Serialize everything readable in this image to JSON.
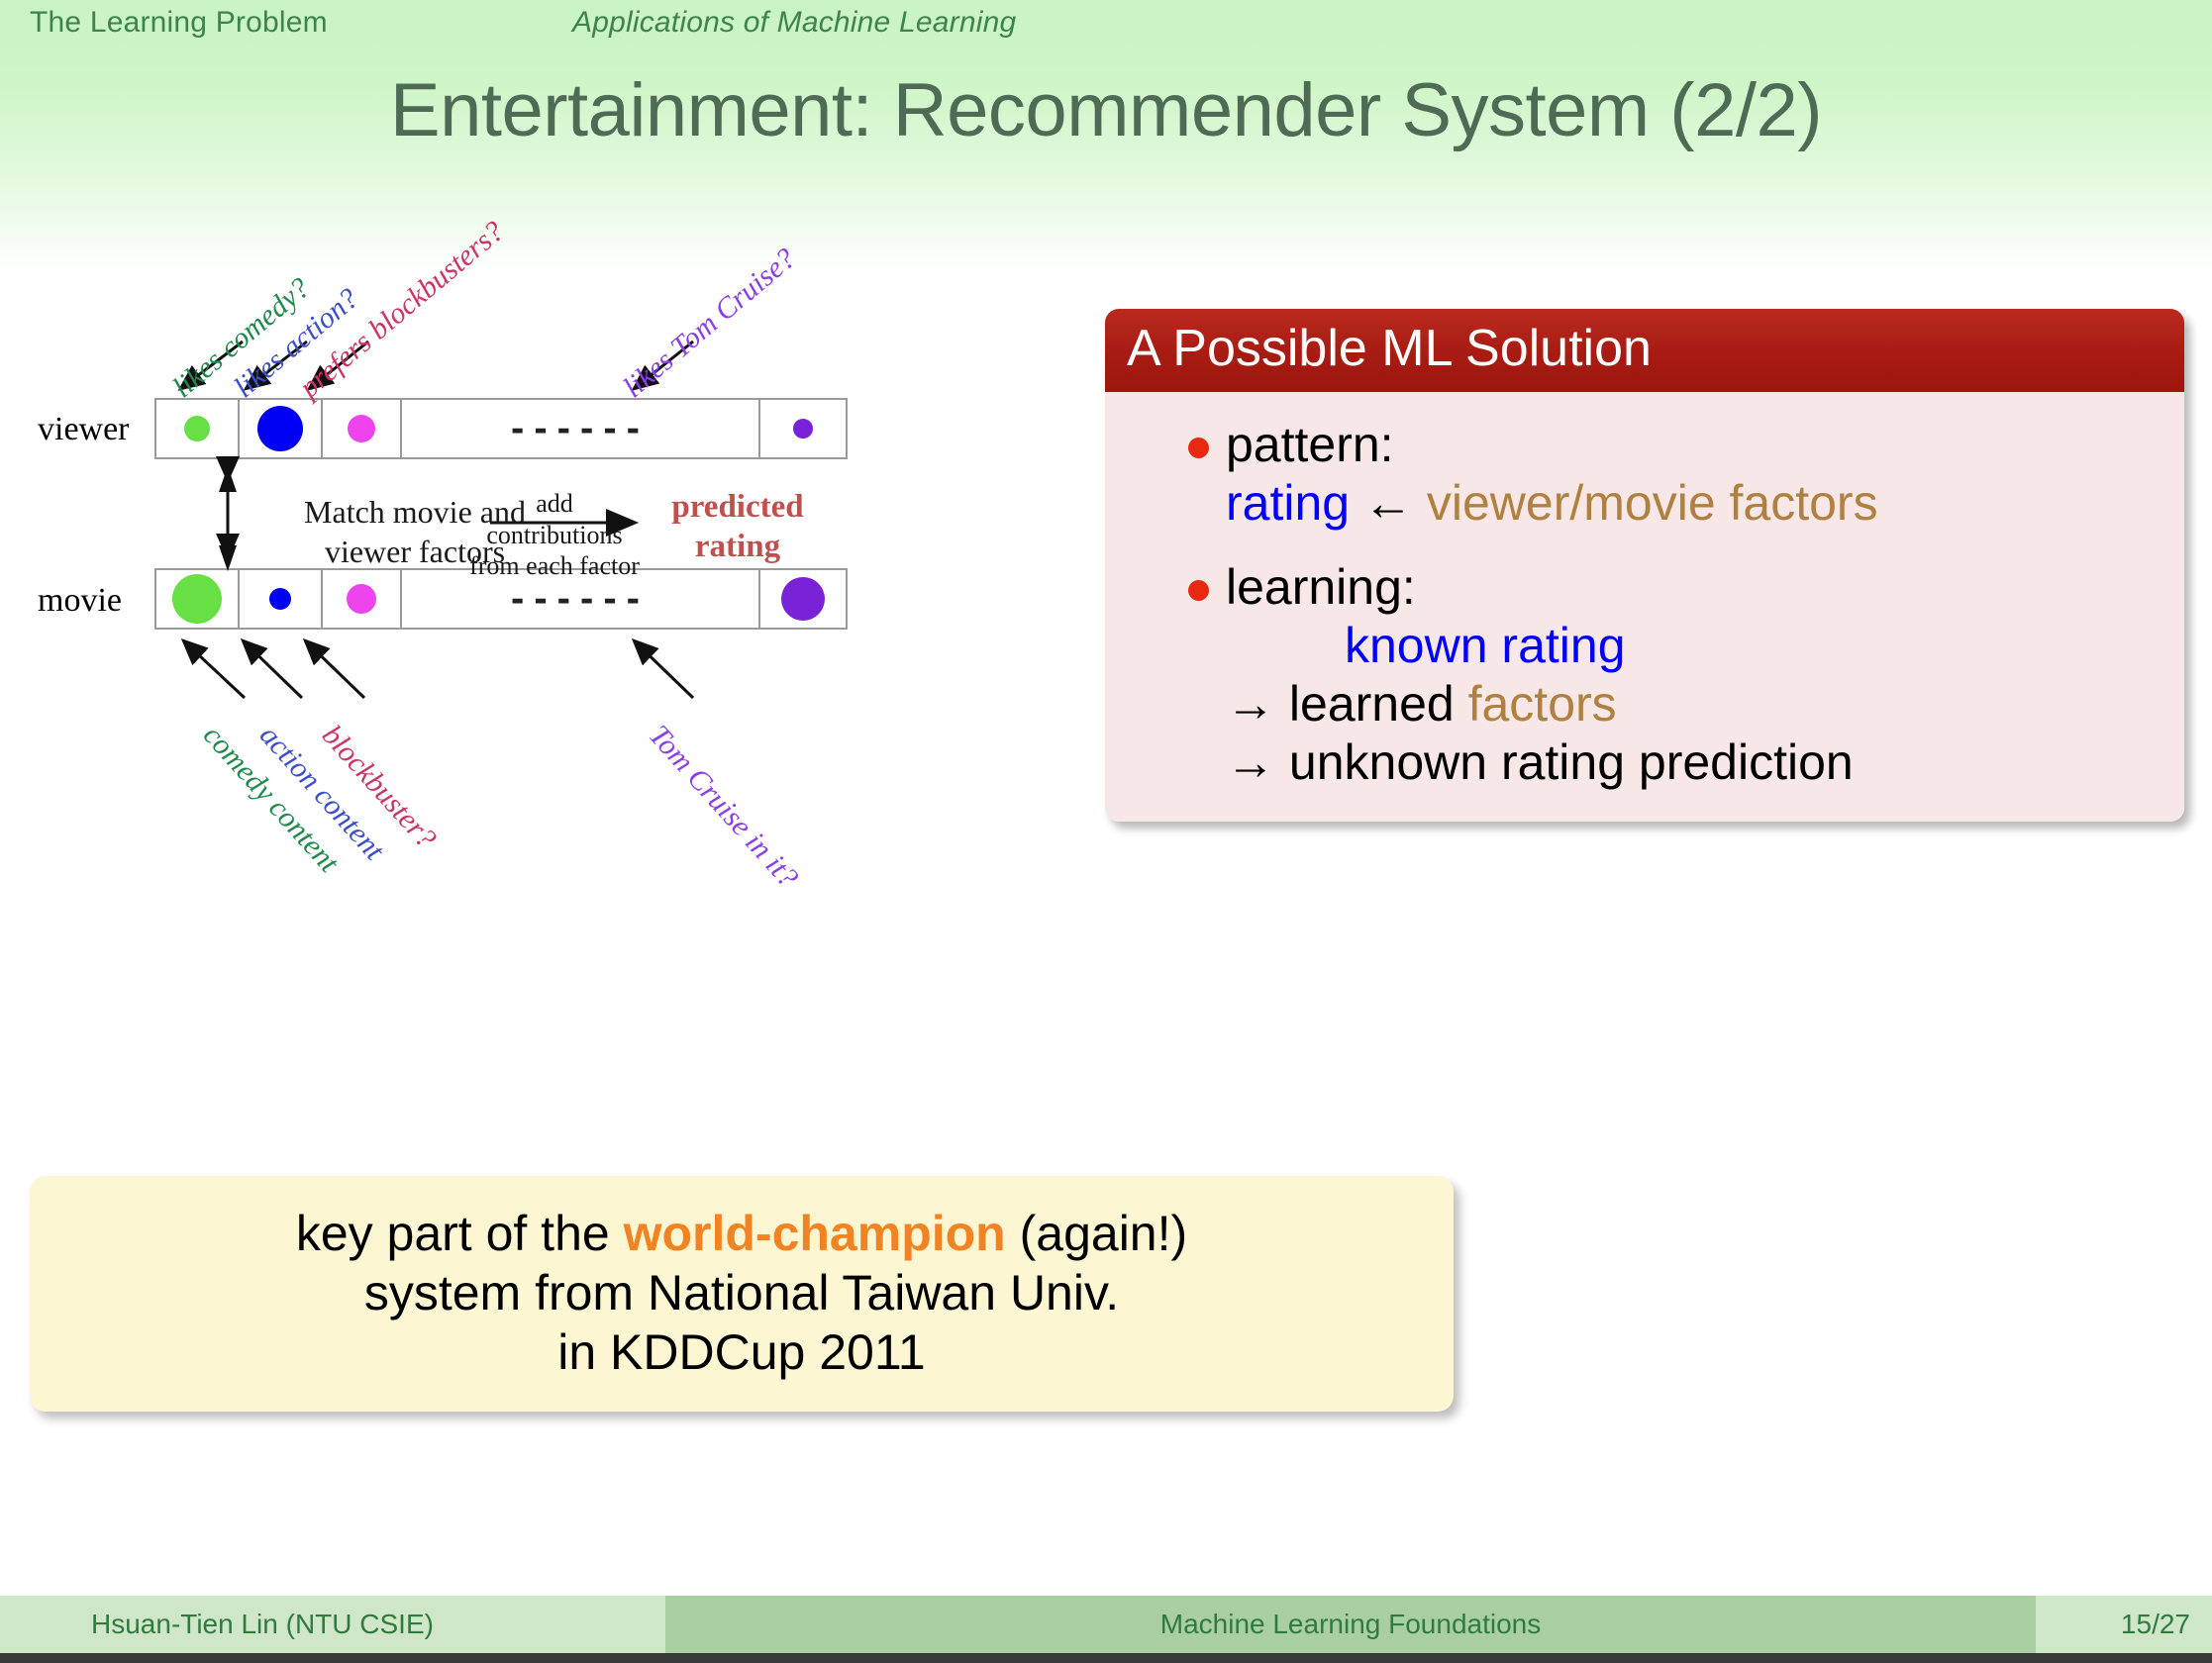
{
  "nav": {
    "section": "The Learning Problem",
    "subsection": "Applications of Machine Learning"
  },
  "title": "Entertainment: Recommender System (2/2)",
  "diagram": {
    "viewer_label": "viewer",
    "movie_label": "movie",
    "ellipsis": "------",
    "viewer_arrow_labels": [
      {
        "text": "likes comedy?",
        "color": "#1f8a4c"
      },
      {
        "text": "likes action?",
        "color": "#3b4ecc"
      },
      {
        "text": "prefers blockbusters?",
        "color": "#cc3366"
      },
      {
        "text": "likes Tom Cruise?",
        "color": "#8b3ee8"
      }
    ],
    "movie_arrow_labels": [
      {
        "text": "comedy content",
        "color": "#1f8a4c"
      },
      {
        "text": "action content",
        "color": "#3b4ecc"
      },
      {
        "text": "blockbuster?",
        "color": "#cc3366"
      },
      {
        "text": "Tom Cruise in it?",
        "color": "#8b3ee8"
      }
    ],
    "match_text_line1": "Match movie and",
    "match_text_line2": "viewer factors",
    "add_text_line1": "add contributions",
    "add_text_line2": "from each factor",
    "predicted_line1": "predicted",
    "predicted_line2": "rating",
    "viewer_factors": [
      {
        "color": "#66e045",
        "size": 26
      },
      {
        "color": "#0000f5",
        "size": 46
      },
      {
        "color": "#ee44ee",
        "size": 28
      },
      {
        "color": "#7a22d8",
        "size": 20
      }
    ],
    "movie_factors": [
      {
        "color": "#66e045",
        "size": 50
      },
      {
        "color": "#0000f5",
        "size": 22
      },
      {
        "color": "#ee44ee",
        "size": 30
      },
      {
        "color": "#7a22d8",
        "size": 44
      }
    ]
  },
  "ml_block": {
    "heading": "A Possible ML Solution",
    "pattern_label": "pattern:",
    "pattern_rating": "rating",
    "pattern_arrow": "←",
    "pattern_factors": "viewer/movie factors",
    "learning_label": "learning:",
    "learning_known": "known rating",
    "learning_line2_arrow": "→",
    "learning_line2_a": "learned",
    "learning_line2_b": "factors",
    "learning_line3_arrow": "→",
    "learning_line3": "unknown rating prediction"
  },
  "callout": {
    "line1_a": "key part of the",
    "line1_b": "world-champion",
    "line1_c": "(again!)",
    "line2": "system from National Taiwan Univ.",
    "line3": "in KDDCup 2011"
  },
  "footer": {
    "author": "Hsuan-Tien Lin  (NTU CSIE)",
    "course": "Machine Learning Foundations",
    "page": "15/27"
  },
  "colors": {
    "title": "#4d6b55",
    "nav": "#3f8348",
    "ml_header_bg": "#a81b12",
    "ml_body_bg": "#f7e7e7",
    "bullet": "#e8280f",
    "blue": "#0000ff",
    "brown": "#b08040",
    "orange": "#f28322",
    "callout_bg": "#fcf6d2",
    "predicted_red": "#c0504d",
    "footer_light": "#cfe6c8",
    "footer_mid": "#a9cea1"
  }
}
